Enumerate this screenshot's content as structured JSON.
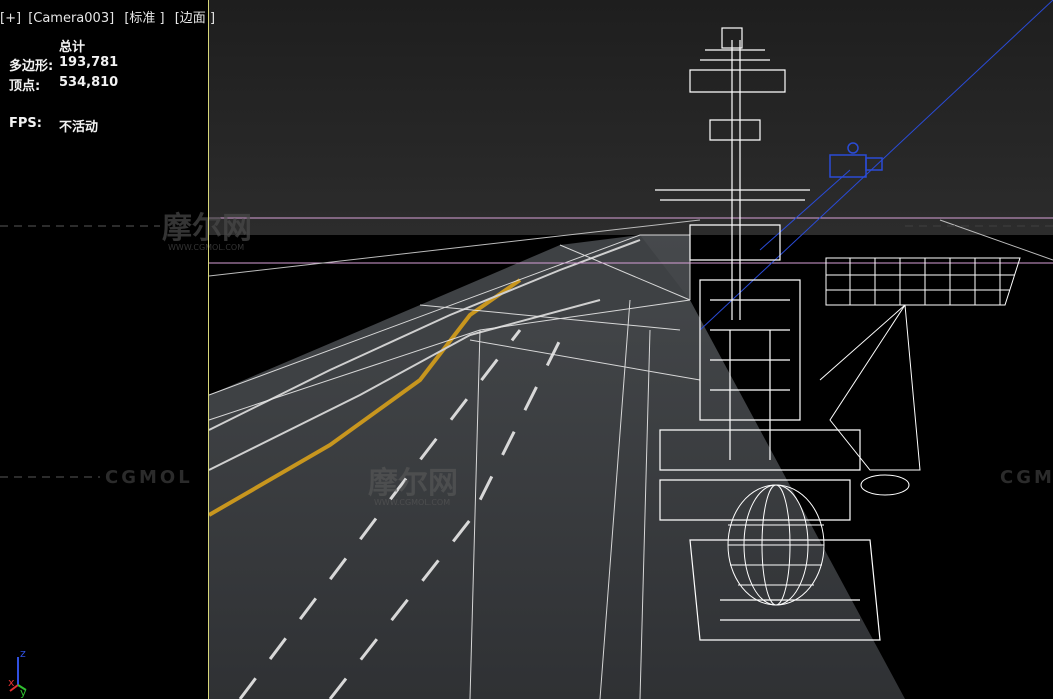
{
  "viewport": {
    "plus": "[+]",
    "camera": "[Camera003]",
    "shading": "[标准 ]",
    "mode": "[边面 ]"
  },
  "stats": {
    "header": "总计",
    "polygons_label": "多边形:",
    "polygons_value": "193,781",
    "vertices_label": "顶点:",
    "vertices_value": "534,810",
    "fps_label": "FPS:",
    "fps_value": "不活动"
  },
  "watermark": {
    "brand_cn": "摩尔网",
    "brand_url": "WWW.CGMOL.COM",
    "brand_en": "CGMOL"
  },
  "axis": {
    "z": "z",
    "x": "x",
    "y": "y"
  },
  "colors": {
    "sky_top": "#1c1c1c",
    "deck": "#3a3d40",
    "wire": "#ffffff",
    "stripe": "#c8961e",
    "guide_pink": "#d7a0d7",
    "camera_blue": "#2a4bd6",
    "viewport_border": "#d7d77a"
  }
}
